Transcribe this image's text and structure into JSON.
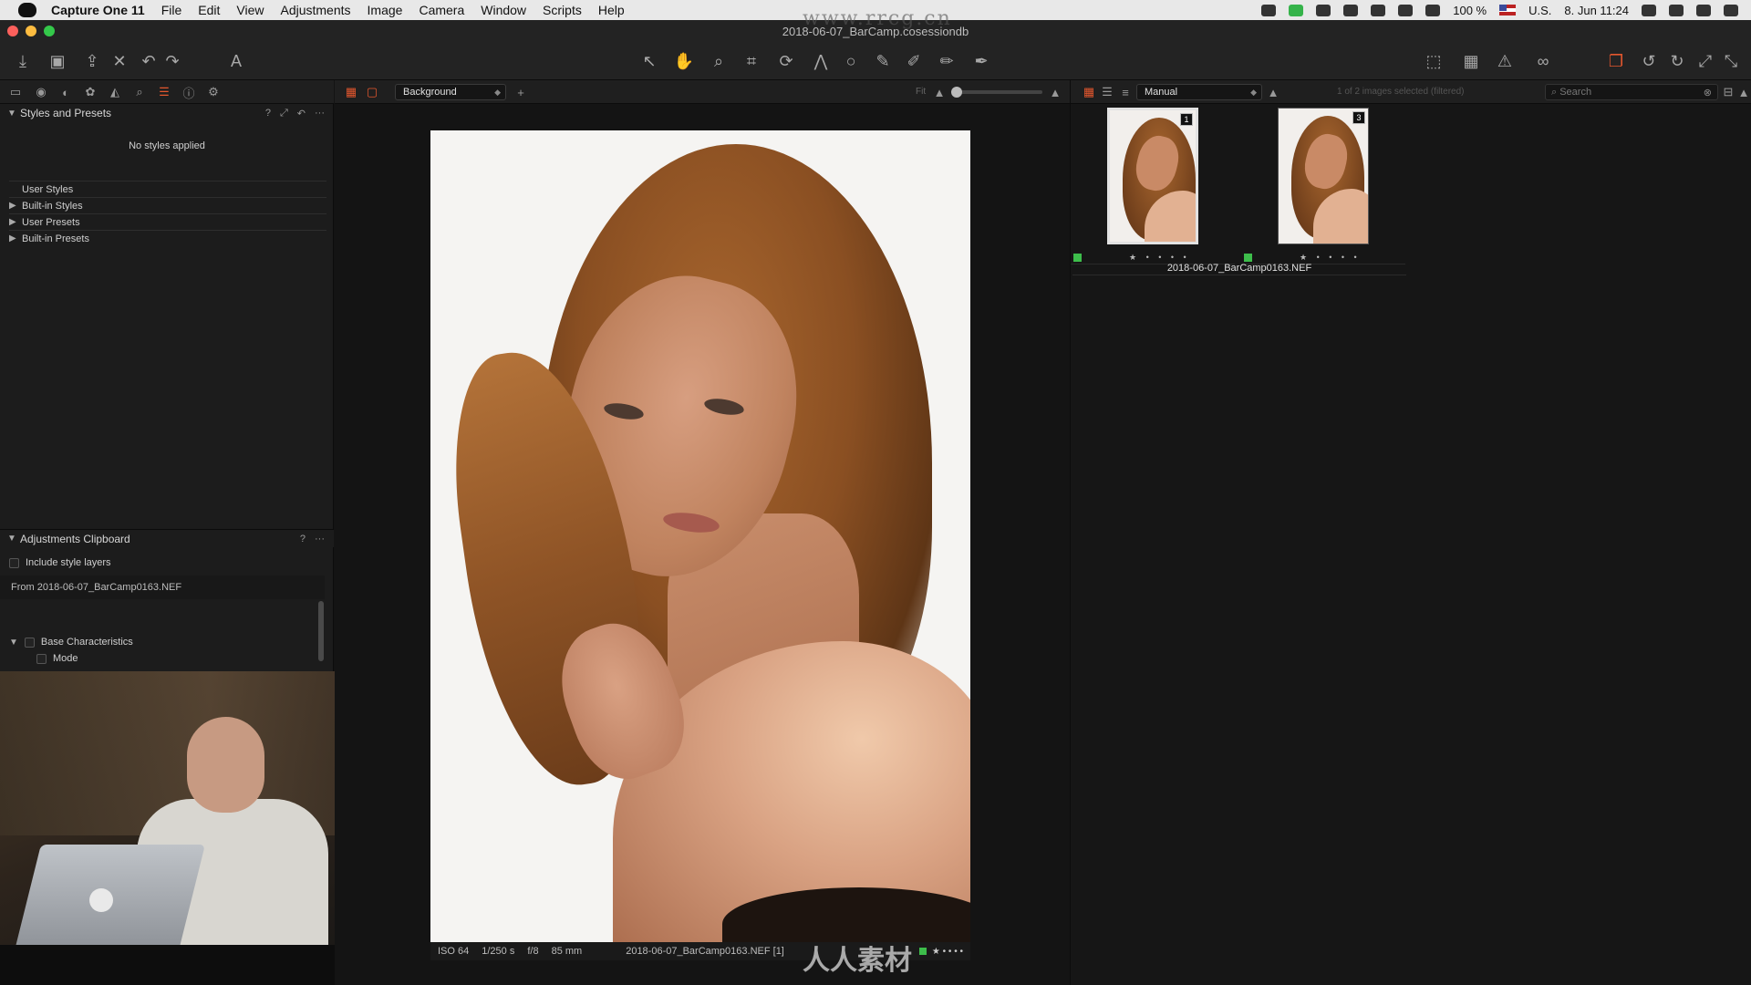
{
  "menubar": {
    "app_name": "Capture One 11",
    "items": [
      "File",
      "Edit",
      "View",
      "Adjustments",
      "Image",
      "Camera",
      "Window",
      "Scripts",
      "Help"
    ],
    "battery": "100 %",
    "locale": "U.S.",
    "datetime": "8. Jun  11:24"
  },
  "window": {
    "title": "2018-06-07_BarCamp.cosessiondb"
  },
  "left_panel": {
    "styles_section": {
      "title": "Styles and Presets",
      "help": "?",
      "empty_text": "No styles applied",
      "rows": [
        {
          "label": "User Styles"
        },
        {
          "label": "Built-in Styles"
        },
        {
          "label": "User Presets"
        },
        {
          "label": "Built-in Presets"
        }
      ]
    },
    "clipboard_section": {
      "title": "Adjustments Clipboard",
      "help": "?",
      "include_layers_label": "Include style layers",
      "from_label": "From 2018-06-07_BarCamp0163.NEF",
      "base_label": "Base Characteristics",
      "mode_label": "Mode"
    }
  },
  "viewer": {
    "layer_select": "Background",
    "fit_label": "Fit",
    "info": {
      "iso": "ISO 64",
      "shutter": "1/250 s",
      "aperture": "f/8",
      "focal": "85 mm",
      "filename": "2018-06-07_BarCamp0163.NEF [1]",
      "stars": "★ • • • •"
    }
  },
  "browser": {
    "sort_select": "Manual",
    "selection_count": "1 of 2 images selected (filtered)",
    "search_placeholder": "Search",
    "thumbnails": [
      {
        "badge": "1",
        "stars": "★ • • • •",
        "selected": true
      },
      {
        "badge": "3",
        "stars": "★ • • • •",
        "selected": false
      }
    ],
    "filename": "2018-06-07_BarCamp0163.NEF"
  },
  "overlay": {
    "watermark": "www.rrcg.cn",
    "logo_text": "人人素材"
  },
  "colors": {
    "accent": "#e4572e",
    "color_tag": "#3dbd4b",
    "panel_bg": "#1c1c1c",
    "viewer_bg": "#141414"
  }
}
